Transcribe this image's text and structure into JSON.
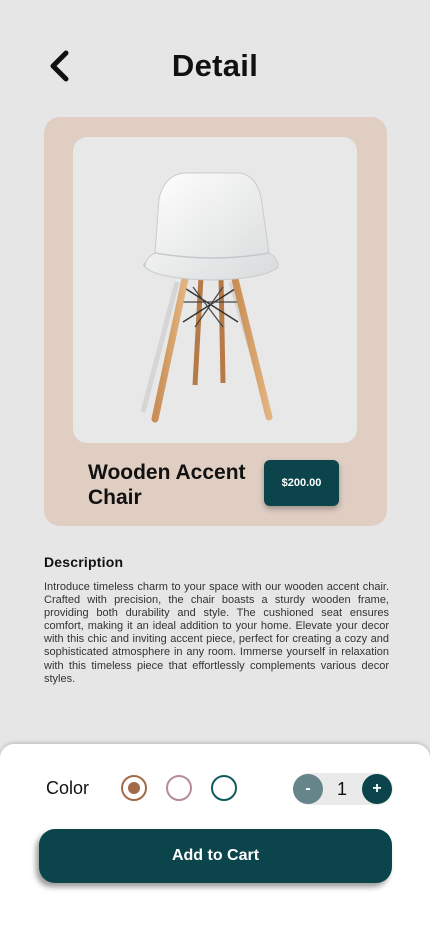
{
  "header": {
    "title": "Detail",
    "back_icon": "chevron-left-icon"
  },
  "product": {
    "name": "Wooden Accent Chair",
    "price": "$200.00",
    "image": "white-chair-with-wooden-legs"
  },
  "description": {
    "title": "Description",
    "text": "Introduce timeless charm to your space with our wooden accent chair. Crafted with precision, the chair boasts a sturdy wooden frame, providing both durability and style. The cushioned seat ensures comfort, making it an ideal addition to your home. Elevate your decor with this chic and inviting accent piece, perfect for creating a cozy and sophisticated atmosphere in any room. Immerse yourself in relaxation with this timeless piece that effortlessly complements various decor styles."
  },
  "options": {
    "color_label": "Color",
    "colors": [
      {
        "name": "brown",
        "hex": "#a06b46",
        "selected": true
      },
      {
        "name": "mauve",
        "hex": "#b58c96",
        "selected": false
      },
      {
        "name": "teal",
        "hex": "#0f5a63",
        "selected": false
      }
    ],
    "quantity": "1",
    "minus_label": "-",
    "plus_label": "+"
  },
  "cart": {
    "button_label": "Add to Cart"
  },
  "colors": {
    "background": "#e6e6e6",
    "card": "#e0cec3",
    "primary": "#0b444b"
  }
}
